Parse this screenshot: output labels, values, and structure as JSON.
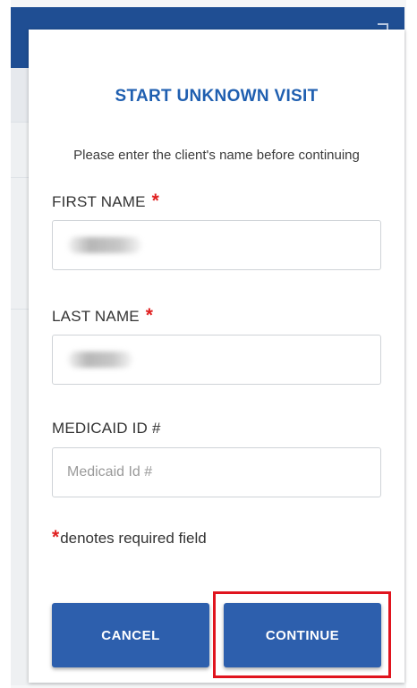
{
  "modal": {
    "title": "START UNKNOWN VISIT",
    "subtitle": "Please enter the client's name before continuing"
  },
  "fields": {
    "first_name": {
      "label": "FIRST NAME",
      "required_mark": "*",
      "value": ""
    },
    "last_name": {
      "label": "LAST NAME",
      "required_mark": "*",
      "value": ""
    },
    "medicaid_id": {
      "label": "MEDICAID ID #",
      "placeholder": "Medicaid Id #",
      "value": ""
    }
  },
  "required_note": {
    "mark": "*",
    "text": "denotes required field"
  },
  "buttons": {
    "cancel": "CANCEL",
    "continue": "CONTINUE"
  },
  "colors": {
    "header": "#1f4e93",
    "title": "#1f5fb0",
    "button": "#2d5fad",
    "required": "#e02020",
    "highlight": "#e0141e"
  }
}
